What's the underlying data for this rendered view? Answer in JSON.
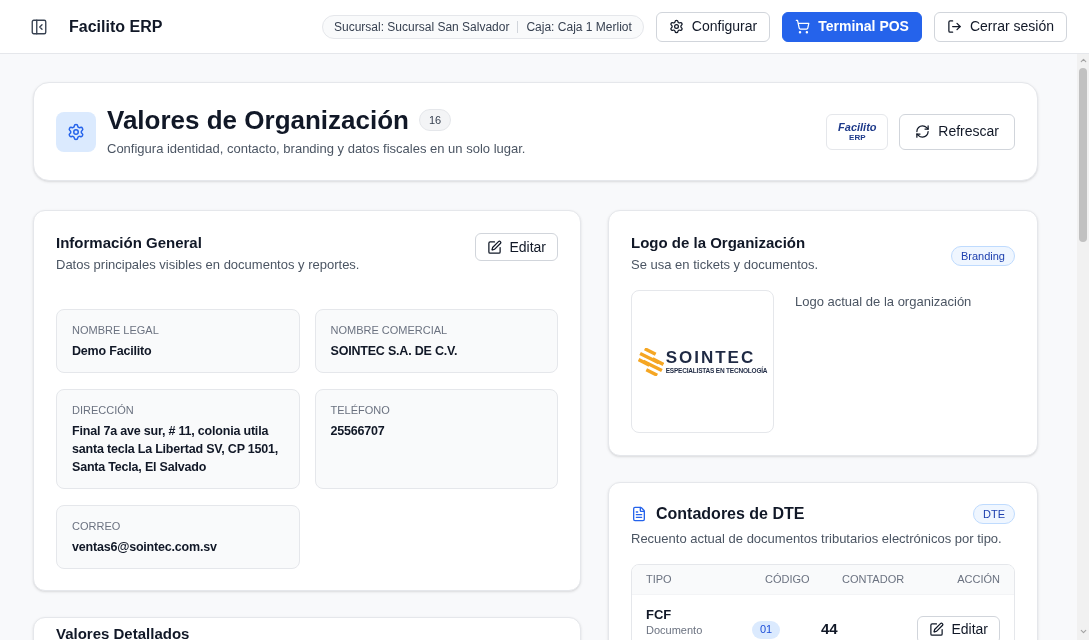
{
  "topbar": {
    "app_title": "Facilito ERP",
    "context": [
      {
        "label": "Sucursal: Sucursal San Salvador"
      },
      {
        "label": "Caja: Caja 1 Merliot"
      }
    ],
    "buttons": [
      {
        "label": "Configurar",
        "kind": "settings"
      },
      {
        "label": "Terminal POS",
        "kind": "primary"
      },
      {
        "label": "Cerrar sesión",
        "kind": "logout"
      }
    ]
  },
  "header": {
    "title": "Valores de Organización",
    "count": "16",
    "subtitle": "Configura identidad, contacto, branding y datos fiscales en un solo lugar.",
    "logo": {
      "wordmark": "Facilito",
      "subtext": "ERP"
    },
    "refresh_button": "Refrescar"
  },
  "general_info": {
    "title": "Información General",
    "subtitle": "Datos principales visibles en documentos y reportes.",
    "edit_button": "Editar",
    "fields": [
      {
        "label": "NOMBRE LEGAL",
        "value": "Demo Facilito"
      },
      {
        "label": "NOMBRE COMERCIAL",
        "value": "SOINTEC S.A. DE C.V."
      },
      {
        "label": "DIRECCIÓN",
        "value": "Final 7a ave sur, # 11, colonia utila santa tecla La Libertad SV, CP 1501, Santa Tecla, El Salvado"
      },
      {
        "label": "TELÉFONO",
        "value": "25566707"
      },
      {
        "label": "CORREO",
        "value": "ventas6@sointec.com.sv"
      }
    ]
  },
  "details_card": {
    "title": "Valores Detallados"
  },
  "logo_card": {
    "title": "Logo de la Organización",
    "subtitle": "Se usa en tickets y documentos.",
    "badge": "Branding",
    "logo": {
      "wordmark": "SOINTEC",
      "tagline": "ESPECIALISTAS EN TECNOLOGÍA"
    },
    "caption": "Logo actual de la organización"
  },
  "dte_counters": {
    "title": "Contadores de DTE",
    "badge": "DTE",
    "subtitle": "Recuento actual de documentos tributarios electrónicos por tipo.",
    "table": {
      "columns": [
        "TIPO",
        "CÓDIGO",
        "CONTADOR",
        "ACCIÓN"
      ],
      "rows": [
        {
          "type": "FCF",
          "description": "Documento",
          "code": "01",
          "count": "44",
          "action": "Editar"
        }
      ]
    }
  }
}
